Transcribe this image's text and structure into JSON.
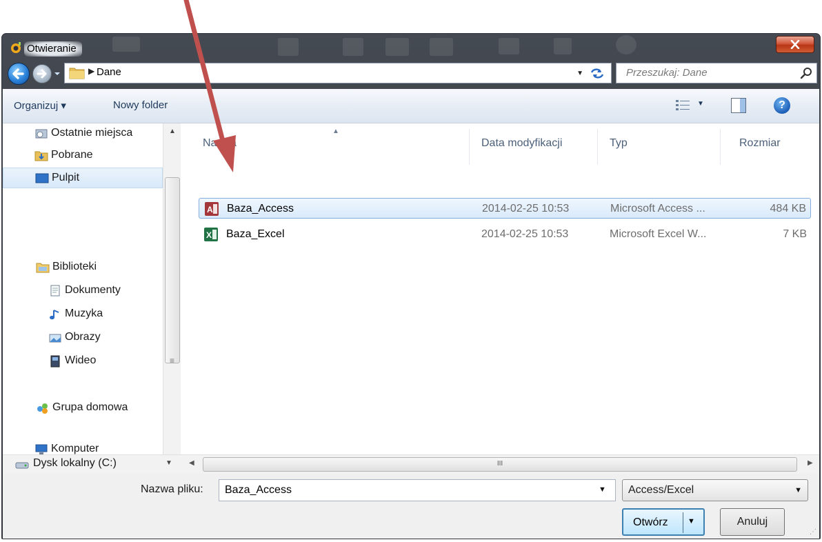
{
  "window": {
    "title": "Otwieranie"
  },
  "nav": {
    "path_segment": "Dane",
    "search_placeholder": "Przeszukaj: Dane"
  },
  "toolbar": {
    "organize_label": "Organizuj ▾",
    "new_folder_label": "Nowy folder"
  },
  "sidebar": {
    "items": [
      {
        "label": "Ostatnie miejsca",
        "icon": "recent-places-icon"
      },
      {
        "label": "Pobrane",
        "icon": "downloads-folder-icon"
      },
      {
        "label": "Pulpit",
        "icon": "desktop-icon",
        "selected": true
      },
      {
        "label": "Biblioteki",
        "icon": "libraries-icon"
      },
      {
        "label": "Dokumenty",
        "icon": "documents-icon"
      },
      {
        "label": "Muzyka",
        "icon": "music-icon"
      },
      {
        "label": "Obrazy",
        "icon": "pictures-icon"
      },
      {
        "label": "Wideo",
        "icon": "video-icon"
      },
      {
        "label": "Grupa domowa",
        "icon": "homegroup-icon"
      },
      {
        "label": "Komputer",
        "icon": "computer-icon"
      },
      {
        "label": "Dysk lokalny (C:)",
        "icon": "local-disk-icon"
      }
    ]
  },
  "columns": {
    "name": "Nazwa",
    "date": "Data modyfikacji",
    "type": "Typ",
    "size": "Rozmiar"
  },
  "files": [
    {
      "name": "Baza_Access",
      "date": "2014-02-25 10:53",
      "type": "Microsoft Access ...",
      "size": "484 KB",
      "icon": "access-file-icon",
      "selected": true
    },
    {
      "name": "Baza_Excel",
      "date": "2014-02-25 10:53",
      "type": "Microsoft Excel W...",
      "size": "7 KB",
      "icon": "excel-file-icon",
      "selected": false
    }
  ],
  "footer": {
    "filename_label": "Nazwa pliku:",
    "filename_value": "Baza_Access",
    "filetype_value": "Access/Excel",
    "open_label": "Otwórz",
    "cancel_label": "Anuluj"
  },
  "colors": {
    "annotation_arrow": "#c0504d",
    "selection_border": "#84acdd",
    "access_icon": "#a4373a",
    "excel_icon": "#217346"
  }
}
